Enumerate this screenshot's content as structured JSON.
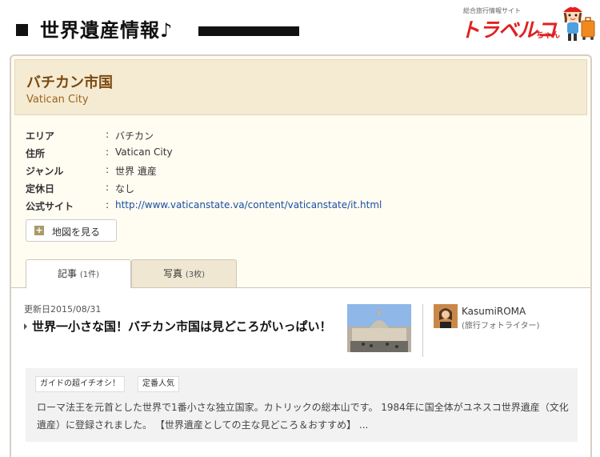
{
  "header": {
    "title": "世界遺産情報♪",
    "logo": {
      "sub_text": "総合旅行情報サイト",
      "main_text": "トラベルコ",
      "suffix": "ちゃん",
      "mascot": "girl-mascot-with-suitcase"
    }
  },
  "place": {
    "name_ja": "バチカン市国",
    "name_en": "Vatican City"
  },
  "info": [
    {
      "label": "エリア",
      "sep": ":",
      "value": "バチカン"
    },
    {
      "label": "住所",
      "sep": ":",
      "value": "Vatican City"
    },
    {
      "label": "ジャンル",
      "sep": ":",
      "value": "世界 遺産"
    },
    {
      "label": "定休日",
      "sep": ":",
      "value": "なし"
    },
    {
      "label": "公式サイト",
      "sep": ":",
      "value": "http://www.vaticanstate.va/content/vaticanstate/it.html"
    }
  ],
  "map_button": {
    "label": "地図を見る",
    "icon": "plus-icon"
  },
  "tabs": [
    {
      "label": "記事",
      "count": "(1件)",
      "active": true
    },
    {
      "label": "写真",
      "count": "(3枚)",
      "active": false
    }
  ],
  "article": {
    "update_date": "更新日2015/08/31",
    "title": "世界一小さな国！バチカン市国は見どころがいっぱい！",
    "author_name": "KasumiROMA",
    "author_role": "(旅行フォトライター)",
    "tags": [
      "ガイドの超イチオシ！",
      "定番人気"
    ],
    "summary": "ローマ法王を元首とした世界で1番小さな独立国家。カトリックの総本山です。 1984年に国全体がユネスコ世界遺産（文化遺産）に登録されました。 【世界遺産としての主な見どころ＆おすすめ】 ..."
  },
  "colors": {
    "accent_brown": "#7a4a10",
    "link_blue": "#1a4fa3",
    "logo_red": "#e02020",
    "panel_bg": "#fffcf2",
    "head_bg": "#f5ebd2"
  }
}
